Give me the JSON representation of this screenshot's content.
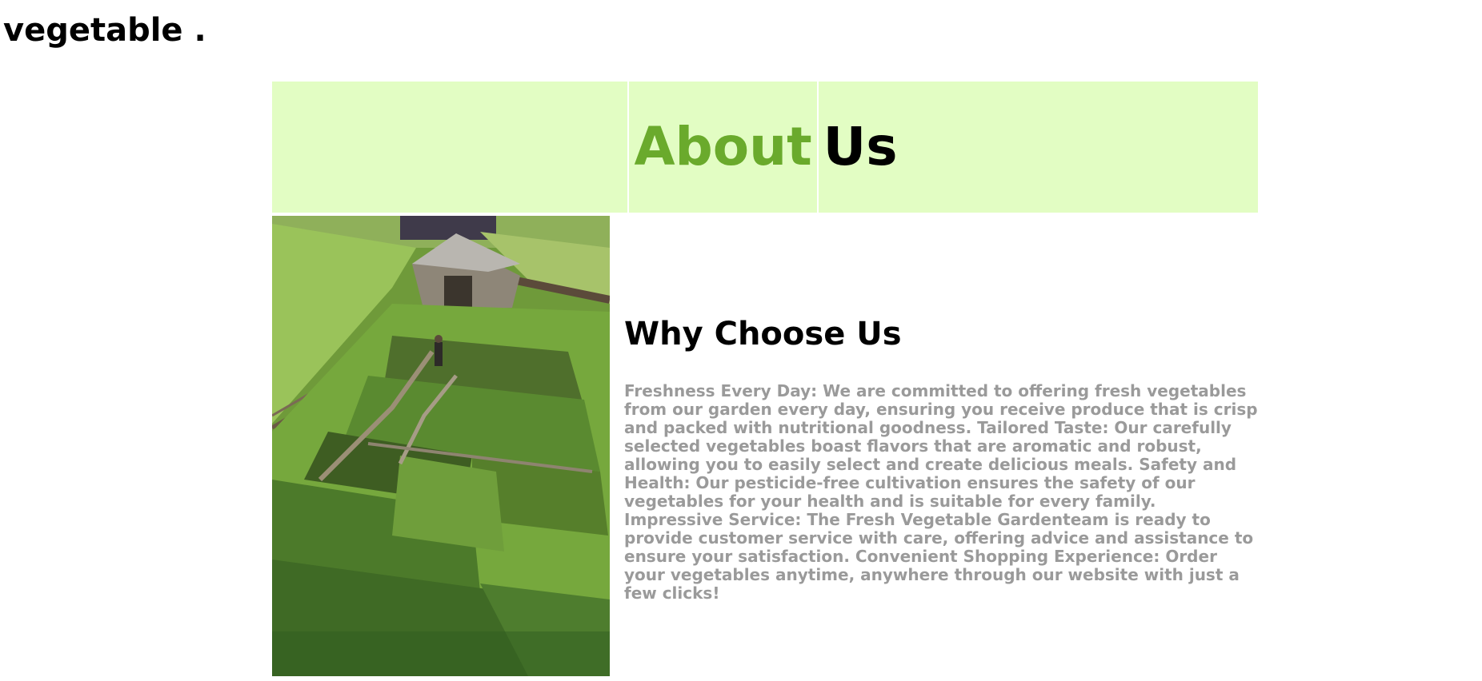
{
  "brand": {
    "name": "vegetable ."
  },
  "hero": {
    "title_accent": "About",
    "title_rest": "Us",
    "accent_color": "#6aaa2c",
    "background_color": "#e2fdc3"
  },
  "about": {
    "image_alt": "Vegetable garden with raised beds and a wooden shed",
    "heading": "Why Choose Us",
    "body": "Freshness Every Day: We are committed to offering fresh vegetables from our garden every day, ensuring you receive produce that is crisp and packed with nutritional goodness. Tailored Taste: Our carefully selected vegetables boast flavors that are aromatic and robust, allowing you to easily select and create delicious meals. Safety and Health: Our pesticide-free cultivation ensures the safety of our vegetables for your health and is suitable for every family. Impressive Service: The Fresh Vegetable Gardenteam is ready to provide customer service with care, offering advice and assistance to ensure your satisfaction. Convenient Shopping Experience: Order your vegetables anytime, anywhere through our website with just a few clicks!"
  }
}
